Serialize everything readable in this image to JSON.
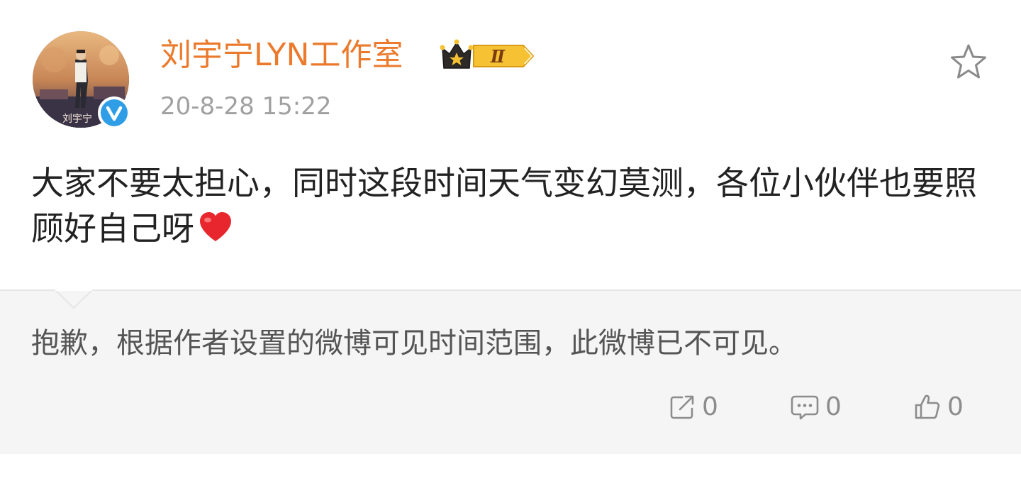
{
  "post": {
    "author": {
      "name": "刘宇宁LYN工作室",
      "avatar_caption": "刘宇宁",
      "badge_level": "Ⅱ",
      "verified_icon": "verified-v-icon"
    },
    "timestamp": "20-8-28 15:22",
    "favorite_icon": "star-outline-icon",
    "content": {
      "text": "大家不要太担心，同时这段时间天气变幻莫测，各位小伙伴也要照顾好自己呀",
      "emoji": "heart-emoji"
    },
    "repost": {
      "notice": "抱歉，根据作者设置的微博可见时间范围，此微博已不可见。"
    },
    "actions": {
      "share": {
        "icon": "share-icon",
        "count": "0"
      },
      "comment": {
        "icon": "comment-icon",
        "count": "0"
      },
      "like": {
        "icon": "thumbs-up-icon",
        "count": "0"
      }
    },
    "colors": {
      "username": "#eb7a2c",
      "verified": "#2f9ee6",
      "heart": "#e8262d",
      "badge_gold": "#f6c234"
    }
  }
}
